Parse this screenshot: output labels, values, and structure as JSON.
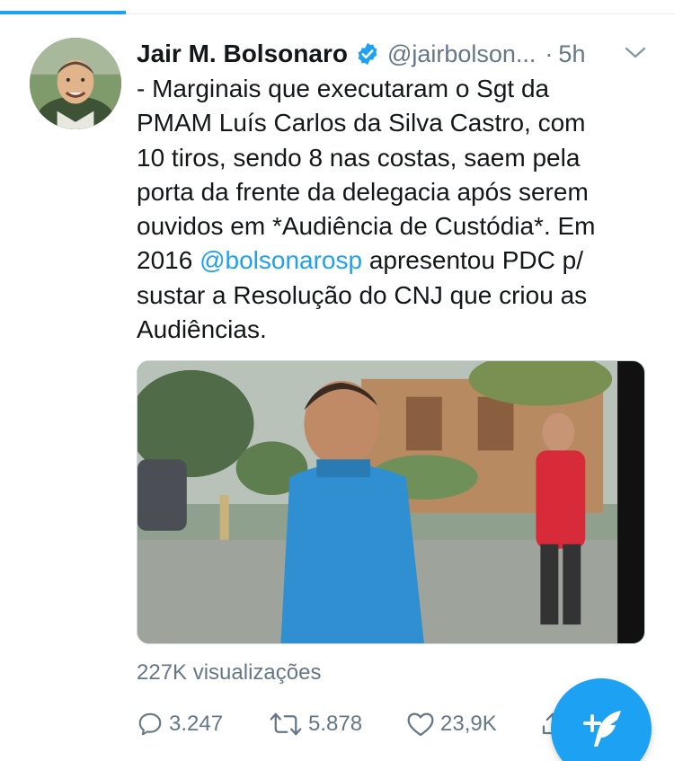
{
  "tweet": {
    "author_name": "Jair M. Bolsonaro",
    "handle": "@jairbolson...",
    "separator": "·",
    "time": "5h",
    "lines": [
      "- Marginais que executaram o Sgt da",
      "PMAM Luís Carlos da Silva Castro, com",
      "10 tiros, sendo 8 nas costas, saem pela",
      "porta da frente da delegacia após serem",
      "ouvidos em *Audiência de Custódia*. Em"
    ],
    "line6_before": "2016 ",
    "mention": "@bolsonarosp",
    "line6_after": " apresentou PDC p/",
    "line7": "sustar a Resolução do CNJ que criou as",
    "line8": "Audiências.",
    "views": "227K visualizações"
  },
  "actions": {
    "replies": "3.247",
    "retweets": "5.878",
    "likes": "23,9K"
  },
  "colors": {
    "accent": "#1da1f2",
    "secondary_text": "#657786",
    "primary_text": "#14171a"
  },
  "icons": [
    "verified-badge-icon",
    "chevron-down-icon",
    "reply-icon",
    "retweet-icon",
    "like-icon",
    "share-icon",
    "compose-tweet-icon"
  ]
}
